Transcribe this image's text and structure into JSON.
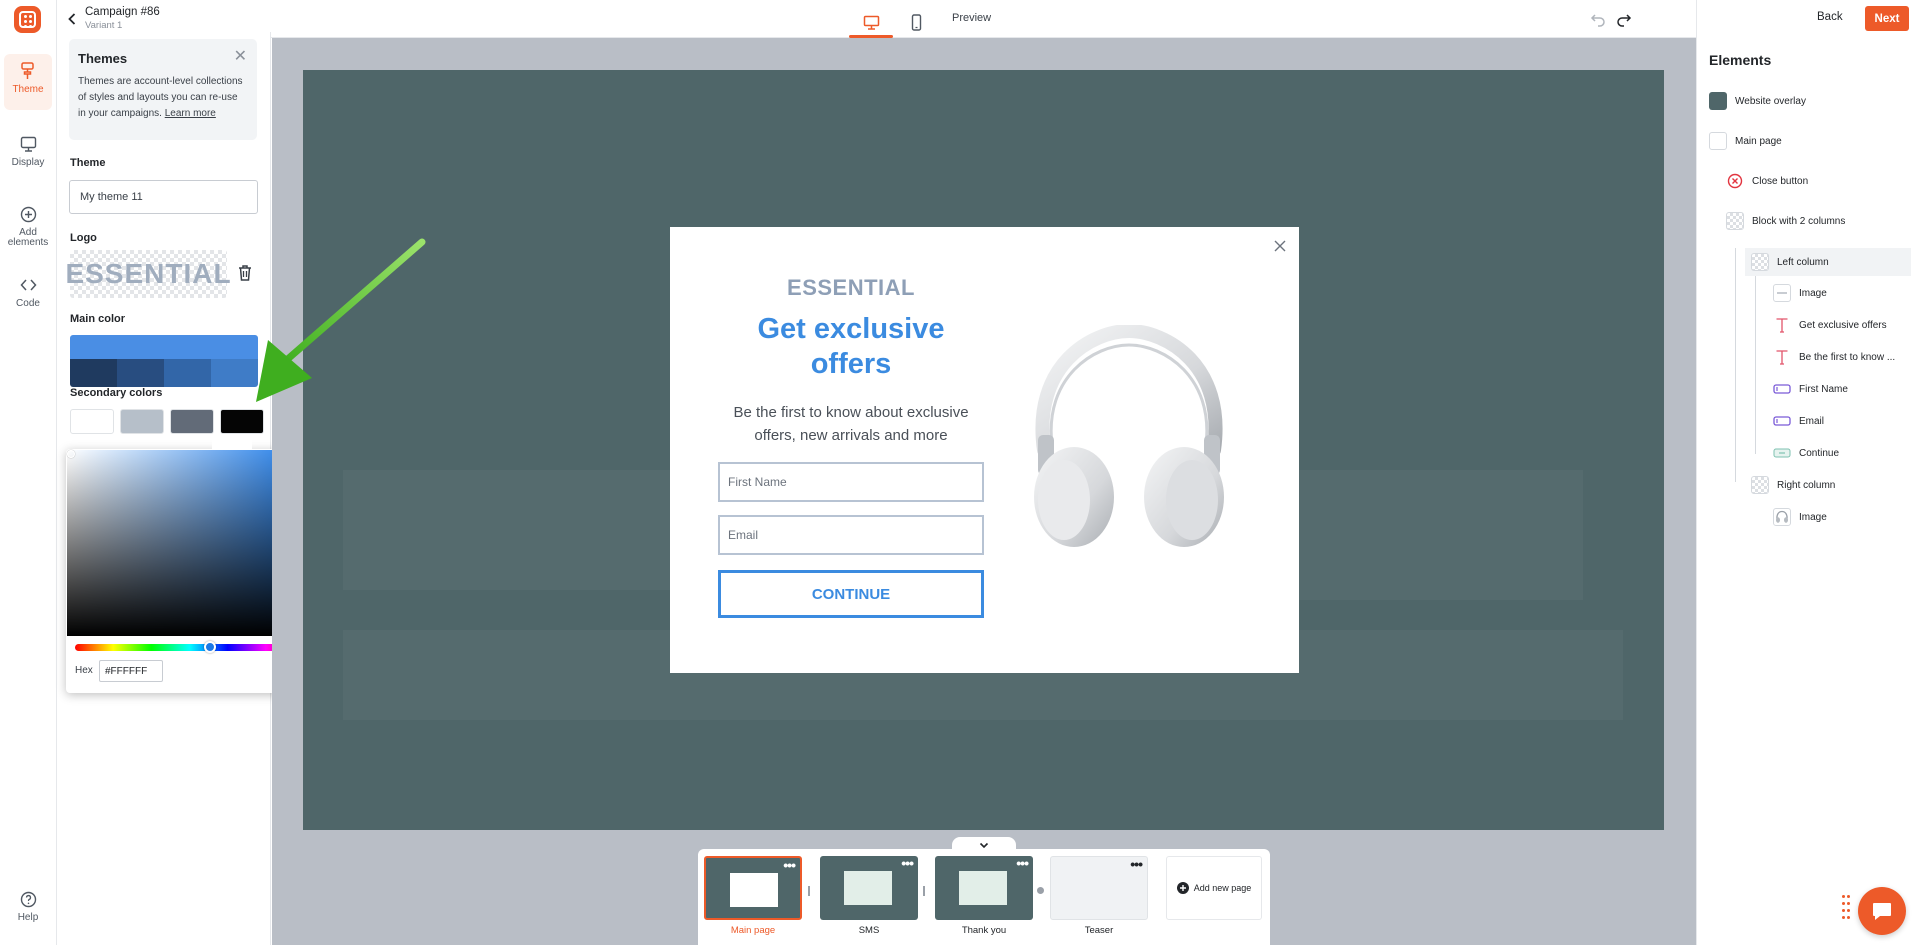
{
  "header": {
    "campaign_title": "Campaign #86",
    "variant": "Variant 1",
    "preview_label": "Preview",
    "back_label": "Back",
    "next_label": "Next"
  },
  "rail": {
    "items": [
      {
        "label": "Theme",
        "icon": "paint-roller-icon",
        "active": true
      },
      {
        "label": "Display",
        "icon": "monitor-icon"
      },
      {
        "label": "Add\nelements",
        "icon": "plus-circle-icon"
      },
      {
        "label": "Code",
        "icon": "code-icon"
      }
    ],
    "help_label": "Help"
  },
  "themes_info": {
    "title": "Themes",
    "text": "Themes are account-level collections of styles and layouts you can re-use in your campaigns.",
    "link": "Learn more"
  },
  "theme": {
    "label": "Theme",
    "value": "My theme 11",
    "logo_label": "Logo",
    "logo_text": "ESSENTIAL",
    "main_color_label": "Main color",
    "main_color": "#4a8ee4",
    "main_shades": [
      "#1f3a5f",
      "#284d80",
      "#3266a8",
      "#3f7cc7"
    ],
    "secondary_label": "Secondary colors",
    "secondary_colors": [
      "#ffffff",
      "#b6bfc9",
      "#626b78",
      "#050505"
    ]
  },
  "picker": {
    "hex_label": "Hex",
    "hex_value": "#FFFFFF",
    "hue_color": "#1a78e6"
  },
  "popup": {
    "brand": "ESSENTIAL",
    "headline": "Get exclusive offers",
    "subtitle": "Be the first to know about exclusive offers, new arrivals and more",
    "first_name_placeholder": "First Name",
    "email_placeholder": "Email",
    "cta": "CONTINUE",
    "overlay_color": "#4f6669",
    "accent": "#3b8be0"
  },
  "pages": {
    "items": [
      {
        "label": "Main page",
        "selected": true
      },
      {
        "label": "SMS"
      },
      {
        "label": "Thank you"
      },
      {
        "label": "Teaser"
      }
    ],
    "add_label": "Add new page"
  },
  "elements": {
    "title": "Elements",
    "items": [
      {
        "label": "Website overlay",
        "level": 0,
        "icon": "overlay-swatch-icon"
      },
      {
        "label": "Main page",
        "level": 0,
        "icon": "page-icon"
      },
      {
        "label": "Close button",
        "level": 1,
        "icon": "close-circle-icon"
      },
      {
        "label": "Block with 2 columns",
        "level": 1,
        "icon": "block-icon"
      },
      {
        "label": "Left column",
        "level": 2,
        "icon": "column-icon",
        "highlighted": true
      },
      {
        "label": "Image",
        "level": 3,
        "icon": "image-icon"
      },
      {
        "label": "Get exclusive offers",
        "level": 3,
        "icon": "text-icon"
      },
      {
        "label": "Be the first to know ...",
        "level": 3,
        "icon": "text-icon"
      },
      {
        "label": "First Name",
        "level": 3,
        "icon": "input-icon"
      },
      {
        "label": "Email",
        "level": 3,
        "icon": "input-icon"
      },
      {
        "label": "Continue",
        "level": 3,
        "icon": "button-icon"
      },
      {
        "label": "Right column",
        "level": 2,
        "icon": "column-icon"
      },
      {
        "label": "Image",
        "level": 3,
        "icon": "headphones-thumb-icon"
      }
    ]
  }
}
